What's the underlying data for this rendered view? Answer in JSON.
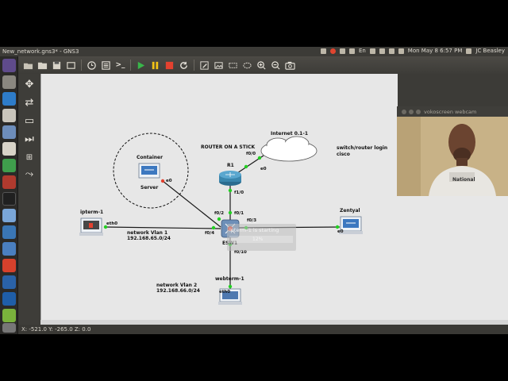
{
  "window": {
    "title": "New_network.gns3* - GNS3"
  },
  "tray": {
    "datetime": "Mon May 8  6:57 PM",
    "user": "JC Beasley",
    "lang": "En"
  },
  "toolbar": {
    "icons": [
      "open-folder-icon",
      "folder-icon",
      "save-icon",
      "snapshot-icon",
      "clock-icon",
      "device-list-icon",
      "console-icon",
      "start-icon",
      "pause-icon",
      "stop-icon",
      "reload-icon",
      "edit-note-icon",
      "image-icon",
      "rectangle-icon",
      "ellipse-icon",
      "zoom-in-icon",
      "zoom-out-icon",
      "screenshot-icon"
    ],
    "console_symbol": ">_"
  },
  "colors": {
    "link": "#1a1a1a",
    "port_up": "#22d022",
    "start_green": "#39b54a",
    "pause_yellow": "#f3c315",
    "stop_red": "#e4412f"
  },
  "topology": {
    "title": "ROUTER ON A STICK",
    "cloud": {
      "label": "Internet 0.1-1",
      "port": "e0"
    },
    "router": {
      "label": "R1",
      "ports": [
        "f0/0",
        "f1/0"
      ]
    },
    "switch": {
      "label": "ESW1",
      "ports": [
        "f0/1",
        "f0/2",
        "f0/3",
        "f0/4",
        "f0/10"
      ]
    },
    "container": {
      "label": "Container",
      "server_label": "Server",
      "port": "e0"
    },
    "ipterm": {
      "label": "ipterm-1",
      "port": "eth0"
    },
    "zentyal": {
      "label": "Zentyal",
      "port": "e0"
    },
    "webterm": {
      "label": "webterm-1",
      "port": "eth0"
    },
    "note_login": "switch/router login\ncisco",
    "vlan1": "network Vlan 1\n192.168.65.0/24",
    "vlan2": "network Vlan 2\n192.168.66.0/24",
    "toast": {
      "text": "ipterm-1 is starting",
      "percent": "12%"
    }
  },
  "status": {
    "coords": "X: -521.0 Y: -265.0 Z: 0.0"
  },
  "webcam": {
    "title": "vokoscreen webcam",
    "shirt_text": "National"
  }
}
